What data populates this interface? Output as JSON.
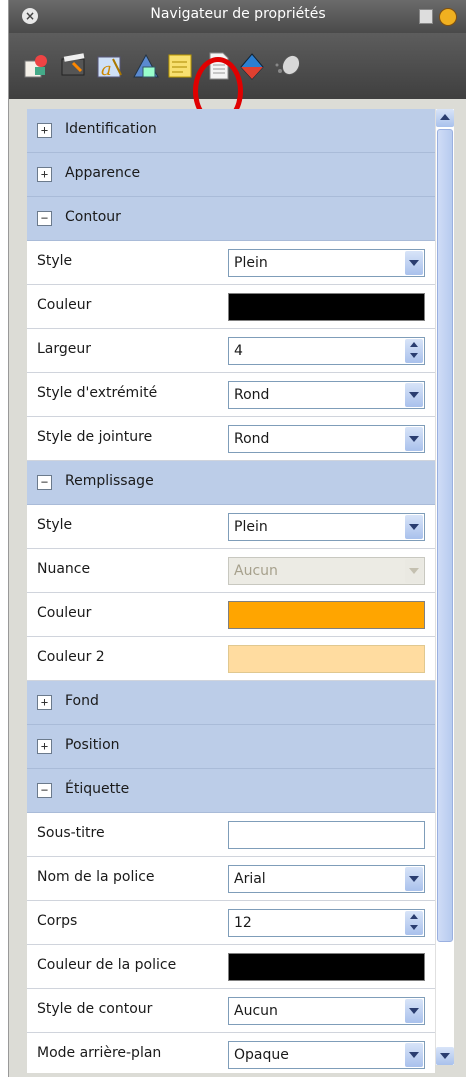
{
  "window": {
    "title": "Navigateur de propriétés"
  },
  "toolbar": {
    "icons": [
      "object-tab-icon",
      "animation-tab-icon",
      "text-format-tab-icon",
      "notes-tab-icon",
      "page-tab-icon",
      "shape-tab-icon",
      "effects-tab-icon"
    ]
  },
  "sections": {
    "identification": {
      "label": "Identification",
      "state": "+"
    },
    "apparence": {
      "label": "Apparence",
      "state": "+"
    },
    "contour": {
      "label": "Contour",
      "state": "−",
      "style": {
        "label": "Style",
        "value": "Plein"
      },
      "couleur": {
        "label": "Couleur",
        "color": "#000000"
      },
      "largeur": {
        "label": "Largeur",
        "value": "4"
      },
      "style_extremite": {
        "label": "Style d'extrémité",
        "value": "Rond"
      },
      "style_jointure": {
        "label": "Style de jointure",
        "value": "Rond"
      }
    },
    "remplissage": {
      "label": "Remplissage",
      "state": "−",
      "style": {
        "label": "Style",
        "value": "Plein"
      },
      "nuance": {
        "label": "Nuance",
        "value": "Aucun"
      },
      "couleur": {
        "label": "Couleur",
        "color": "#ffa500"
      },
      "couleur2": {
        "label": "Couleur 2",
        "color": "#ffdca0"
      }
    },
    "fond": {
      "label": "Fond",
      "state": "+"
    },
    "position": {
      "label": "Position",
      "state": "+"
    },
    "etiquette": {
      "label": "Étiquette",
      "state": "−",
      "sous_titre": {
        "label": "Sous-titre",
        "value": ""
      },
      "nom_police": {
        "label": "Nom de la police",
        "value": "Arial"
      },
      "corps": {
        "label": "Corps",
        "value": "12"
      },
      "couleur_police": {
        "label": "Couleur de la police",
        "color": "#000000"
      },
      "style_contour": {
        "label": "Style de contour",
        "value": "Aucun"
      },
      "mode_arriere_plan": {
        "label": "Mode arrière-plan",
        "value": "Opaque"
      }
    }
  },
  "colors": {
    "section_header": "#bccde8",
    "title_bar": "#4a4a4a",
    "highlight_circle": "#e00000"
  }
}
